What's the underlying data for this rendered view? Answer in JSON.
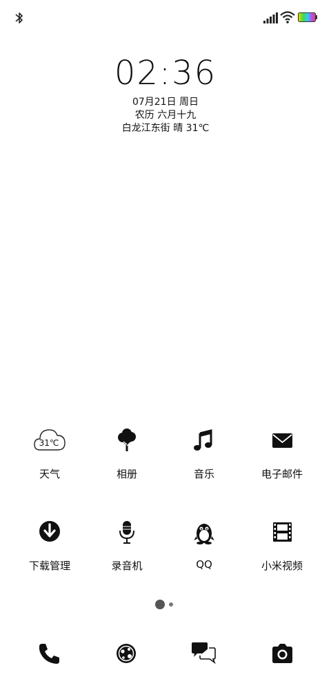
{
  "status_bar": {
    "icons": [
      "bluetooth-icon",
      "signal-icon",
      "wifi-icon",
      "battery-icon"
    ]
  },
  "lockscreen": {
    "time": "02:36",
    "date": "07月21日 周日",
    "lunar": "农历 六月十九",
    "weather": "白龙江东街 晴 31℃"
  },
  "apps": [
    {
      "label": "天气",
      "icon": "weather-cloud-icon",
      "icon_text": "31℃"
    },
    {
      "label": "相册",
      "icon": "tree-icon"
    },
    {
      "label": "音乐",
      "icon": "music-note-icon"
    },
    {
      "label": "电子邮件",
      "icon": "envelope-icon"
    },
    {
      "label": "下载管理",
      "icon": "download-icon"
    },
    {
      "label": "录音机",
      "icon": "microphone-icon"
    },
    {
      "label": "QQ",
      "icon": "penguin-icon"
    },
    {
      "label": "小米视频",
      "icon": "film-icon"
    }
  ],
  "page_indicator": {
    "pages": 2,
    "current": 1
  },
  "dock": [
    {
      "icon": "phone-icon"
    },
    {
      "icon": "browser-icon"
    },
    {
      "icon": "messages-icon"
    },
    {
      "icon": "camera-icon"
    }
  ]
}
